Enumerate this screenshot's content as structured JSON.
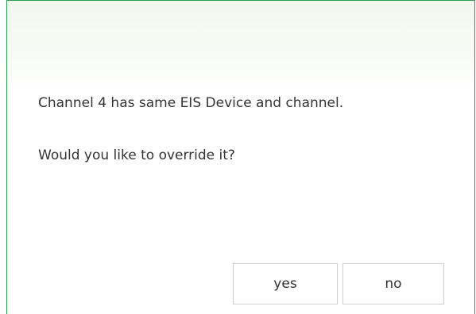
{
  "dialog": {
    "message_line1": "Channel 4 has same EIS Device and channel.",
    "message_line2": "Would you like to override it?",
    "yes_label": "yes",
    "no_label": "no",
    "accent_border_color": "#2e9e52"
  }
}
